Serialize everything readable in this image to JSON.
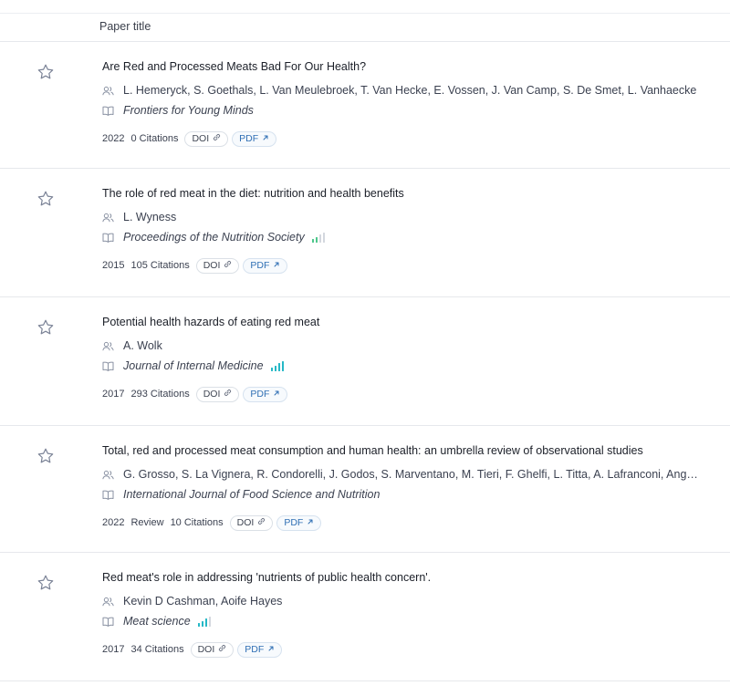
{
  "header": {
    "column_label": "Paper title"
  },
  "colors": {
    "bar_active_green": "#4cc78a",
    "bar_active_teal": "#25b8c6",
    "bar_inactive": "#d3d7de",
    "pdf_blue": "#2f6fb4"
  },
  "papers": [
    {
      "title": "Are Red and Processed Meats Bad For Our Health?",
      "authors": "L. Hemeryck, S. Goethals, L. Van Meulebroek, T. Van Hecke, E. Vossen, J. Van Camp, S. De Smet, L. Vanhaecke",
      "journal": "Frontiers for Young Minds",
      "journal_rank": 0,
      "year": "2022",
      "type": "",
      "citations": "0 Citations",
      "doi_label": "DOI",
      "pdf_label": "PDF"
    },
    {
      "title": "The role of red meat in the diet: nutrition and health benefits",
      "authors": "L. Wyness",
      "journal": "Proceedings of the Nutrition Society",
      "journal_rank": 2,
      "year": "2015",
      "type": "",
      "citations": "105 Citations",
      "doi_label": "DOI",
      "pdf_label": "PDF"
    },
    {
      "title": "Potential health hazards of eating red meat",
      "authors": "A. Wolk",
      "journal": "Journal of Internal Medicine",
      "journal_rank": 4,
      "year": "2017",
      "type": "",
      "citations": "293 Citations",
      "doi_label": "DOI",
      "pdf_label": "PDF"
    },
    {
      "title": "Total, red and processed meat consumption and human health: an umbrella review of observational studies",
      "authors": "G. Grosso, S. La Vignera, R. Condorelli, J. Godos, S. Marventano, M. Tieri, F. Ghelfi, L. Titta, A. Lafranconi, Angelo Ga...",
      "journal": "International Journal of Food Science and Nutrition",
      "journal_rank": 0,
      "year": "2022",
      "type": "Review",
      "citations": "10 Citations",
      "doi_label": "DOI",
      "pdf_label": "PDF"
    },
    {
      "title": "Red meat's role in addressing 'nutrients of public health concern'.",
      "authors": "Kevin D Cashman, Aoife Hayes",
      "journal": "Meat science",
      "journal_rank": 3,
      "year": "2017",
      "type": "",
      "citations": "34 Citations",
      "doi_label": "DOI",
      "pdf_label": "PDF"
    }
  ]
}
